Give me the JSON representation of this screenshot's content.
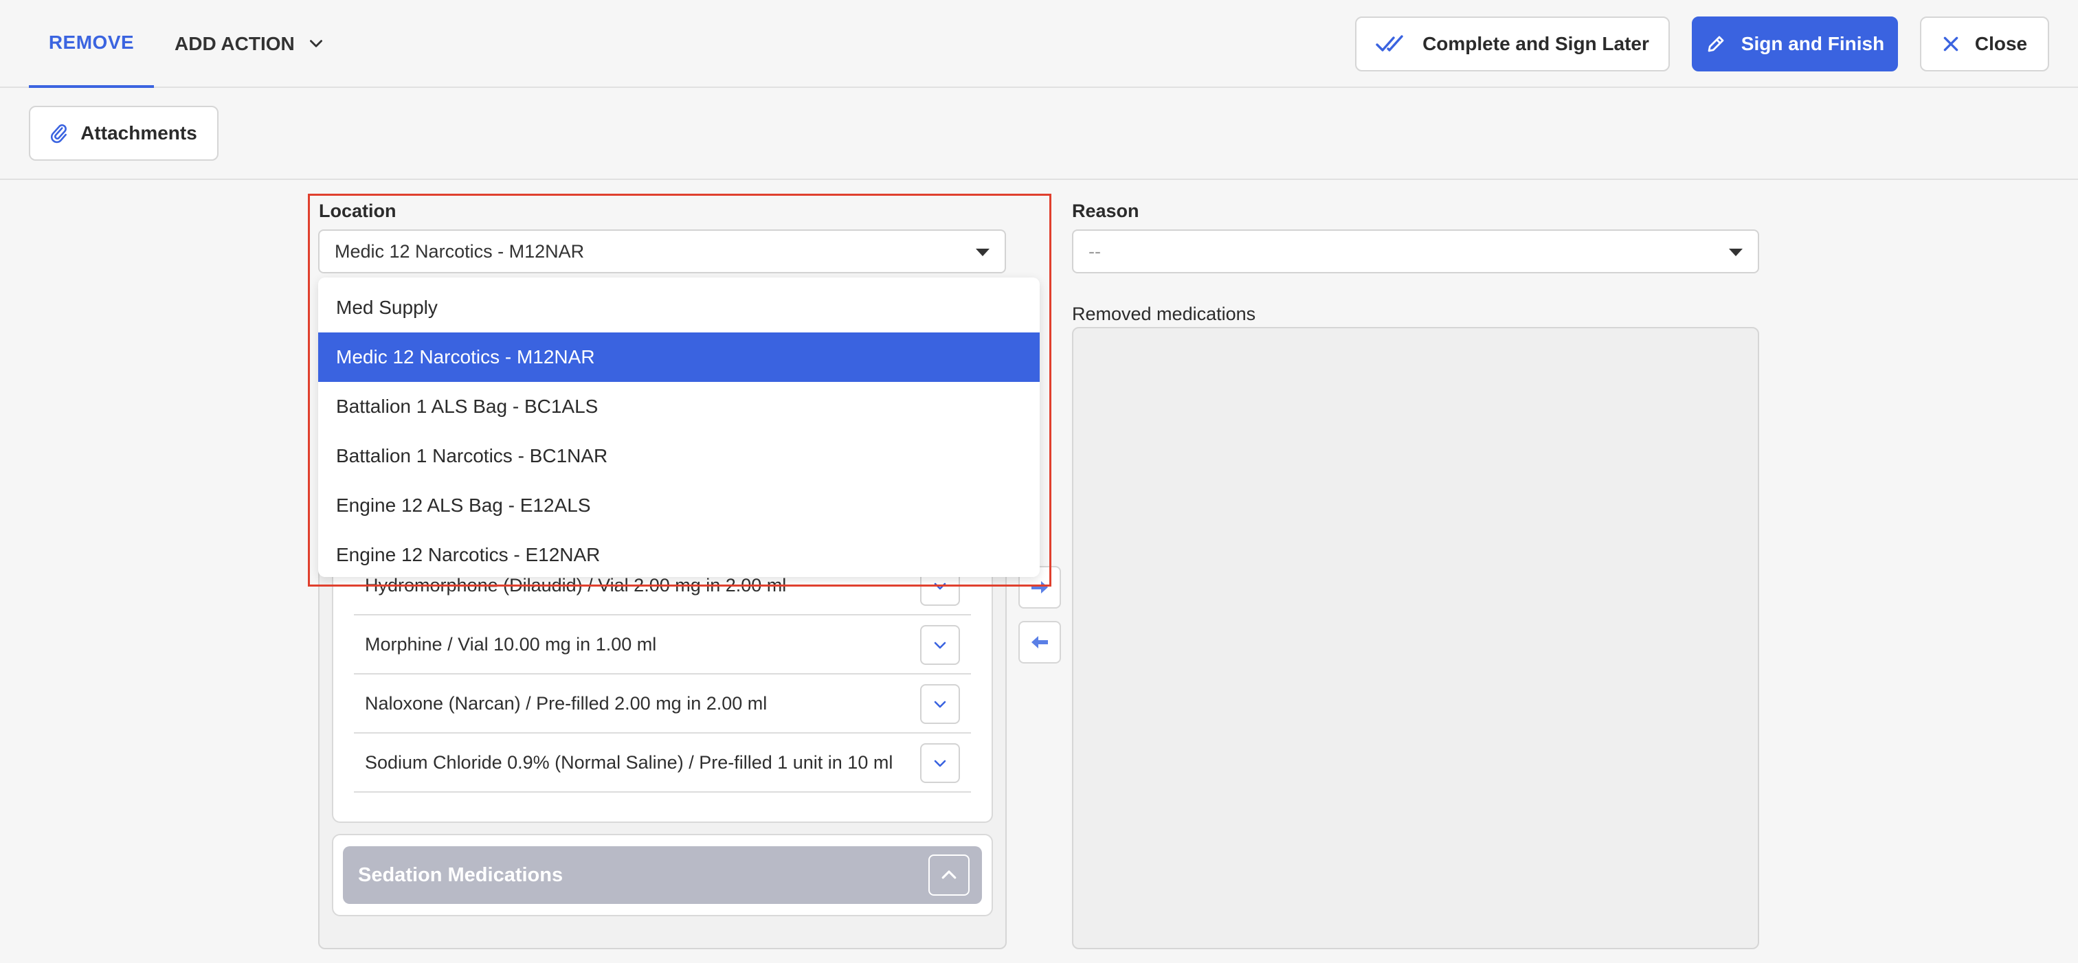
{
  "header": {
    "tab_remove": "REMOVE",
    "add_action": "ADD ACTION",
    "complete_sign_later": "Complete and Sign Later",
    "sign_finish": "Sign and Finish",
    "close": "Close"
  },
  "toolbar": {
    "attachments": "Attachments"
  },
  "location": {
    "label": "Location",
    "selected": "Medic 12 Narcotics - M12NAR",
    "options": [
      "Med Supply",
      "Medic 12 Narcotics - M12NAR",
      "Battalion 1 ALS Bag - BC1ALS",
      "Battalion 1 Narcotics - BC1NAR",
      "Engine 12 ALS Bag - E12ALS",
      "Engine 12 Narcotics - E12NAR"
    ],
    "selected_index": 1
  },
  "reason": {
    "label": "Reason",
    "value": "--"
  },
  "removed": {
    "label": "Removed medications"
  },
  "medications": [
    "Hydromorphone (Dilaudid) / Vial 2.00 mg in 2.00 ml",
    "Morphine / Vial 10.00 mg in 1.00 ml",
    "Naloxone (Narcan) / Pre-filled 2.00 mg in 2.00 ml",
    "Sodium Chloride 0.9% (Normal Saline) / Pre-filled 1 unit in 10 ml"
  ],
  "sedation": {
    "title": "Sedation Medications"
  },
  "colors": {
    "accent": "#3a63e0",
    "highlight": "#e0402e",
    "sedation_header": "#b8bac6"
  }
}
